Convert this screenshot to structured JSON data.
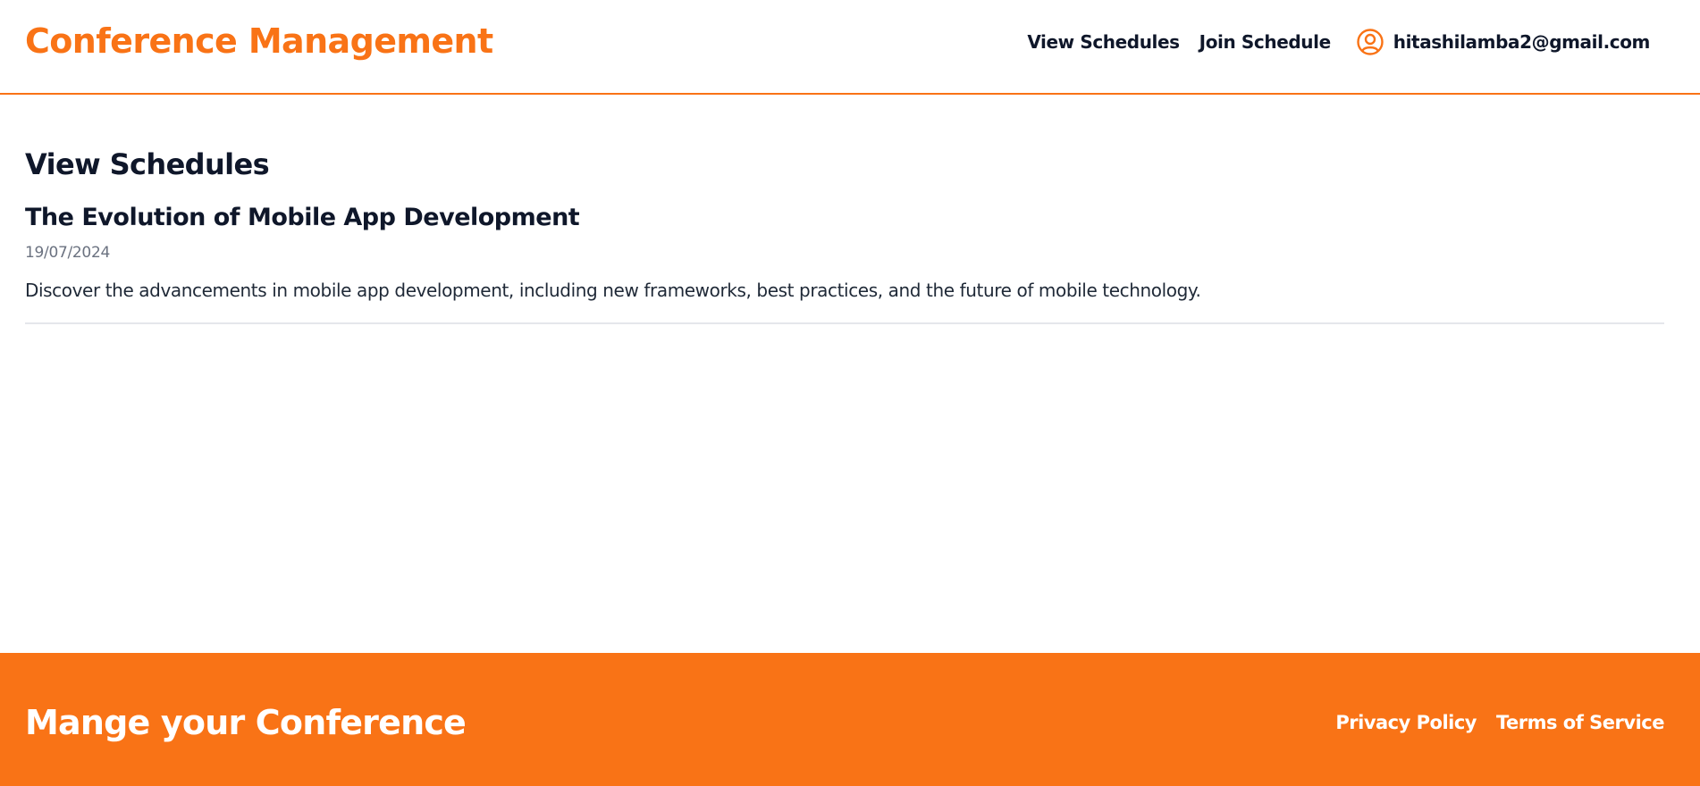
{
  "header": {
    "brand": "Conference Management",
    "nav": {
      "view_schedules": "View Schedules",
      "join_schedule": "Join Schedule"
    },
    "user": {
      "icon": "user-circle-icon",
      "email": "hitashilamba2@gmail.com"
    }
  },
  "main": {
    "title": "View Schedules",
    "schedules": [
      {
        "title": "The Evolution of Mobile App Development",
        "date": "19/07/2024",
        "description": "Discover the advancements in mobile app development, including new frameworks, best practices, and the future of mobile technology."
      }
    ]
  },
  "footer": {
    "tagline": "Mange your Conference",
    "links": {
      "privacy": "Privacy Policy",
      "terms": "Terms of Service"
    }
  },
  "colors": {
    "accent": "#f97316",
    "text": "#0f172a",
    "muted": "#6b7280",
    "divider": "#e5e7eb"
  }
}
